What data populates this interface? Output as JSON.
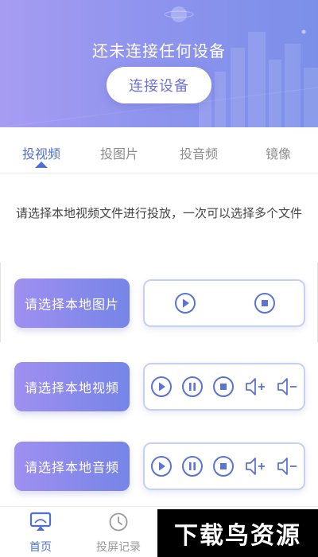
{
  "header": {
    "title": "还未连接任何设备",
    "connect_label": "连接设备"
  },
  "tabs": [
    {
      "label": "投视频",
      "active": true
    },
    {
      "label": "投图片",
      "active": false
    },
    {
      "label": "投音频",
      "active": false
    },
    {
      "label": "镜像",
      "active": false
    }
  ],
  "description": "请选择本地视频文件进行投放，一次可以选择多个文件",
  "rows": [
    {
      "button_label": "请选择本地图片",
      "controls": [
        "play-icon",
        "stop-icon"
      ]
    },
    {
      "button_label": "请选择本地视频",
      "controls": [
        "play-icon",
        "pause-icon",
        "stop-icon",
        "volume-up-icon",
        "volume-down-icon"
      ]
    },
    {
      "button_label": "请选择本地音频",
      "controls": [
        "play-icon",
        "pause-icon",
        "stop-icon",
        "volume-up-icon",
        "volume-down-icon"
      ]
    }
  ],
  "bottom_nav": [
    {
      "label": "首页",
      "icon": "cast-screen-icon",
      "active": true
    },
    {
      "label": "投屏记录",
      "icon": "clock-icon",
      "active": false
    }
  ],
  "watermark": "下载鸟资源",
  "colors": {
    "accent": "#4f6fd8",
    "header_start": "#a79cf2",
    "header_end": "#7b8fe9",
    "button_start": "#9f8ff0",
    "button_end": "#7585e7"
  }
}
